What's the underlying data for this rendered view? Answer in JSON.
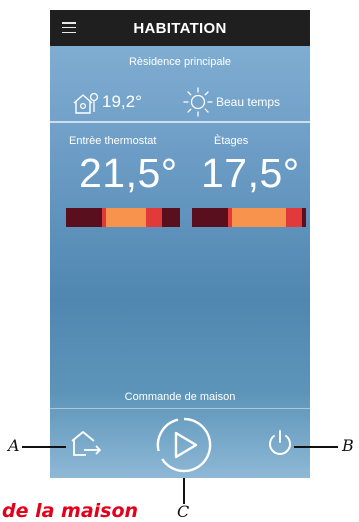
{
  "app": {
    "title": "HABITATION"
  },
  "residence": {
    "name": "Rèsidence principale"
  },
  "weather": {
    "inside_temperature": "19,2°",
    "condition": "Beau temps"
  },
  "zones": [
    {
      "label": "Entrèe thermostat",
      "temperature": "21,5°"
    },
    {
      "label": "Ètages",
      "temperature": "17,5°"
    }
  ],
  "colors": {
    "bar_dark": "#5a0f1e",
    "bar_orange": "#f7934c",
    "bar_red": "#e2393b",
    "topbar": "#1f1f1f"
  },
  "command": {
    "label": "Commande de maison"
  },
  "callouts": {
    "a": "A",
    "b": "B",
    "c": "C"
  },
  "footer_text": "de la maison"
}
